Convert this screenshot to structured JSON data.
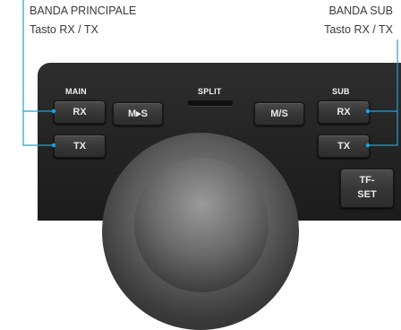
{
  "captions": {
    "left_line1": "BANDA PRINCIPALE",
    "left_line2": "Tasto RX / TX",
    "right_line1": "BANDA SUB",
    "right_line2": "Tasto RX / TX"
  },
  "panel": {
    "main_label": "MAIN",
    "split_label": "SPLIT",
    "sub_label": "SUB",
    "buttons": {
      "main_rx": "RX",
      "main_tx": "TX",
      "m_to_s": "M▸S",
      "m_slash_s": "M/S",
      "sub_rx": "RX",
      "sub_tx": "TX",
      "tf_set_line1": "TF-",
      "tf_set_line2": "SET"
    }
  },
  "colors": {
    "callout_line": "#1aa3d9",
    "panel": "#262626"
  }
}
